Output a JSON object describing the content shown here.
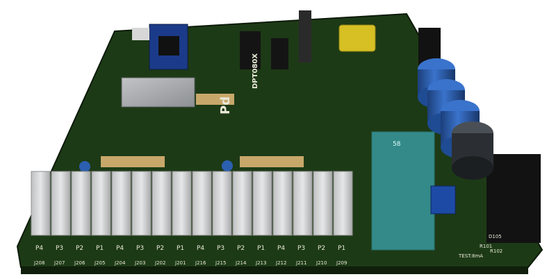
{
  "colors": {
    "background": "#ffffff",
    "pcb": "#1f3a18",
    "pcb_edge": "#0f1f0c",
    "silk": "#e8e8d8",
    "gold": "#c8a86a",
    "terminal": "#d9dadb",
    "cap_blue": "#2b5fb0",
    "transparent_cyan": "#3fb6c6",
    "yellow_part": "#d6c024",
    "black_part": "#111111"
  },
  "board": {
    "labels": {
      "model": "DPT080X",
      "team_1": "Pd",
      "footer_test": "TEST:8mA",
      "left_connector_marks": [
        "P4",
        "P3",
        "P2",
        "P1",
        "P4",
        "P3",
        "P2",
        "P1",
        "P4",
        "P3",
        "P2",
        "P1",
        "P4",
        "P3",
        "P2",
        "P1"
      ],
      "connector_refs": [
        "J208",
        "J207",
        "J206",
        "J205",
        "J204",
        "J203",
        "J202",
        "J201",
        "J216",
        "J215",
        "J214",
        "J213",
        "J212",
        "J211",
        "J210",
        "J209"
      ],
      "right_refs": [
        "R101",
        "R102",
        "D105"
      ],
      "capacitor_label": "58"
    }
  }
}
